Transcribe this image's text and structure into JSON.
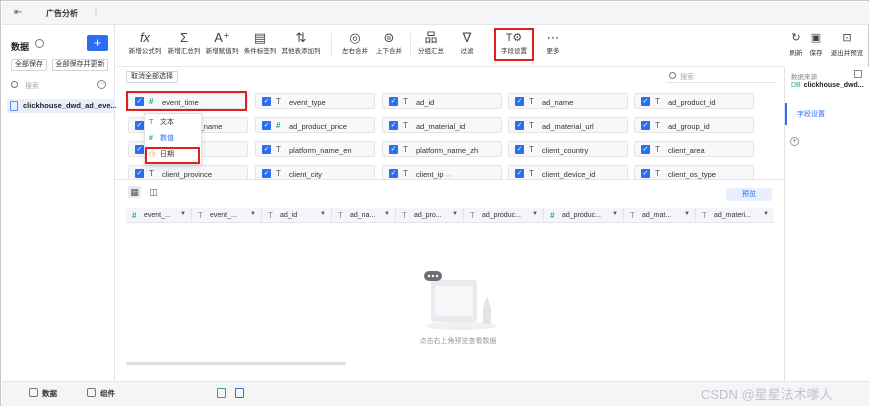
{
  "topbar": {
    "tab_label": "广告分析",
    "more": "⋮"
  },
  "leftpanel": {
    "title": "数据",
    "add": "+",
    "save_all": "全部保存",
    "save_all_update": "全部保存并更新",
    "search_placeholder": "搜索",
    "item": "clickhouse_dwd_ad_eve..."
  },
  "toolbar": {
    "items": [
      {
        "icon": "fx",
        "label": "新增公式列"
      },
      {
        "icon": "Σ",
        "label": "新增汇总列"
      },
      {
        "icon": "A⁺",
        "label": "新增赋值列"
      },
      {
        "icon": "▤",
        "label": "条件标签列"
      },
      {
        "icon": "⇅",
        "label": "其他表添加列"
      },
      {
        "icon": "◎",
        "label": "左右合并"
      },
      {
        "icon": "⊜",
        "label": "上下合并"
      },
      {
        "icon": "品",
        "label": "分组汇总"
      },
      {
        "icon": "∇",
        "label": "过滤"
      },
      {
        "icon": "T⚙",
        "label": "字段设置"
      },
      {
        "icon": "⋯",
        "label": "更多"
      }
    ],
    "right": [
      {
        "icon": "↻",
        "label": "刷新"
      },
      {
        "icon": "▣",
        "label": "保存"
      },
      {
        "icon": "⊡",
        "label": "退出并预览"
      }
    ]
  },
  "rightpanel": {
    "source_label": "数据来源",
    "source_db": "DB",
    "source_name": "clickhouse_dwd...",
    "step": "字段设置",
    "add": "+"
  },
  "fields": {
    "select_all": "取消全部选择",
    "search_placeholder": "搜索",
    "check": "✓",
    "items": [
      {
        "type": "#",
        "name": "event_time"
      },
      {
        "type": "T",
        "name": "event_type"
      },
      {
        "type": "T",
        "name": "ad_id"
      },
      {
        "type": "T",
        "name": "ad_name"
      },
      {
        "type": "T",
        "name": "ad_product_id"
      },
      {
        "type": "T",
        "name": "ad_product_name"
      },
      {
        "type": "#",
        "name": "ad_product_price"
      },
      {
        "type": "T",
        "name": "ad_material_id"
      },
      {
        "type": "T",
        "name": "ad_material_url"
      },
      {
        "type": "T",
        "name": "ad_group_id"
      },
      {
        "type": "T",
        "name": ""
      },
      {
        "type": "T",
        "name": "platform_name_en"
      },
      {
        "type": "T",
        "name": "platform_name_zh"
      },
      {
        "type": "T",
        "name": "client_country"
      },
      {
        "type": "T",
        "name": "client_area"
      },
      {
        "type": "T",
        "name": "client_province"
      },
      {
        "type": "T",
        "name": "client_city"
      },
      {
        "type": "T",
        "name": "client_ip"
      },
      {
        "type": "T",
        "name": "client_device_id"
      },
      {
        "type": "T",
        "name": "client_os_type"
      }
    ],
    "dropdown": [
      {
        "icon": "T",
        "label": "文本"
      },
      {
        "icon": "#",
        "label": "数值"
      },
      {
        "icon": "◷",
        "label": "日期"
      }
    ],
    "split_handle": "⋯"
  },
  "preview": {
    "preview_button": "预览",
    "columns": [
      {
        "type": "#",
        "name": "event_..."
      },
      {
        "type": "T",
        "name": "event_..."
      },
      {
        "type": "T",
        "name": "ad_id"
      },
      {
        "type": "T",
        "name": "ad_na..."
      },
      {
        "type": "T",
        "name": "ad_pro..."
      },
      {
        "type": "T",
        "name": "ad_produc..."
      },
      {
        "type": "#",
        "name": "ad_produc..."
      },
      {
        "type": "T",
        "name": "ad_mat..."
      },
      {
        "type": "T",
        "name": "ad_materi..."
      }
    ],
    "empty_text": "点击右上角预览查看数据"
  },
  "bottombar": {
    "data_tab": "数据",
    "component_tab": "组件"
  },
  "watermark": "CSDN @星星法术嗲人",
  "colors": {
    "accent": "#2a6ef2",
    "highlight": "#e02020",
    "number": "#2fa86a",
    "date": "#e79a2a"
  }
}
